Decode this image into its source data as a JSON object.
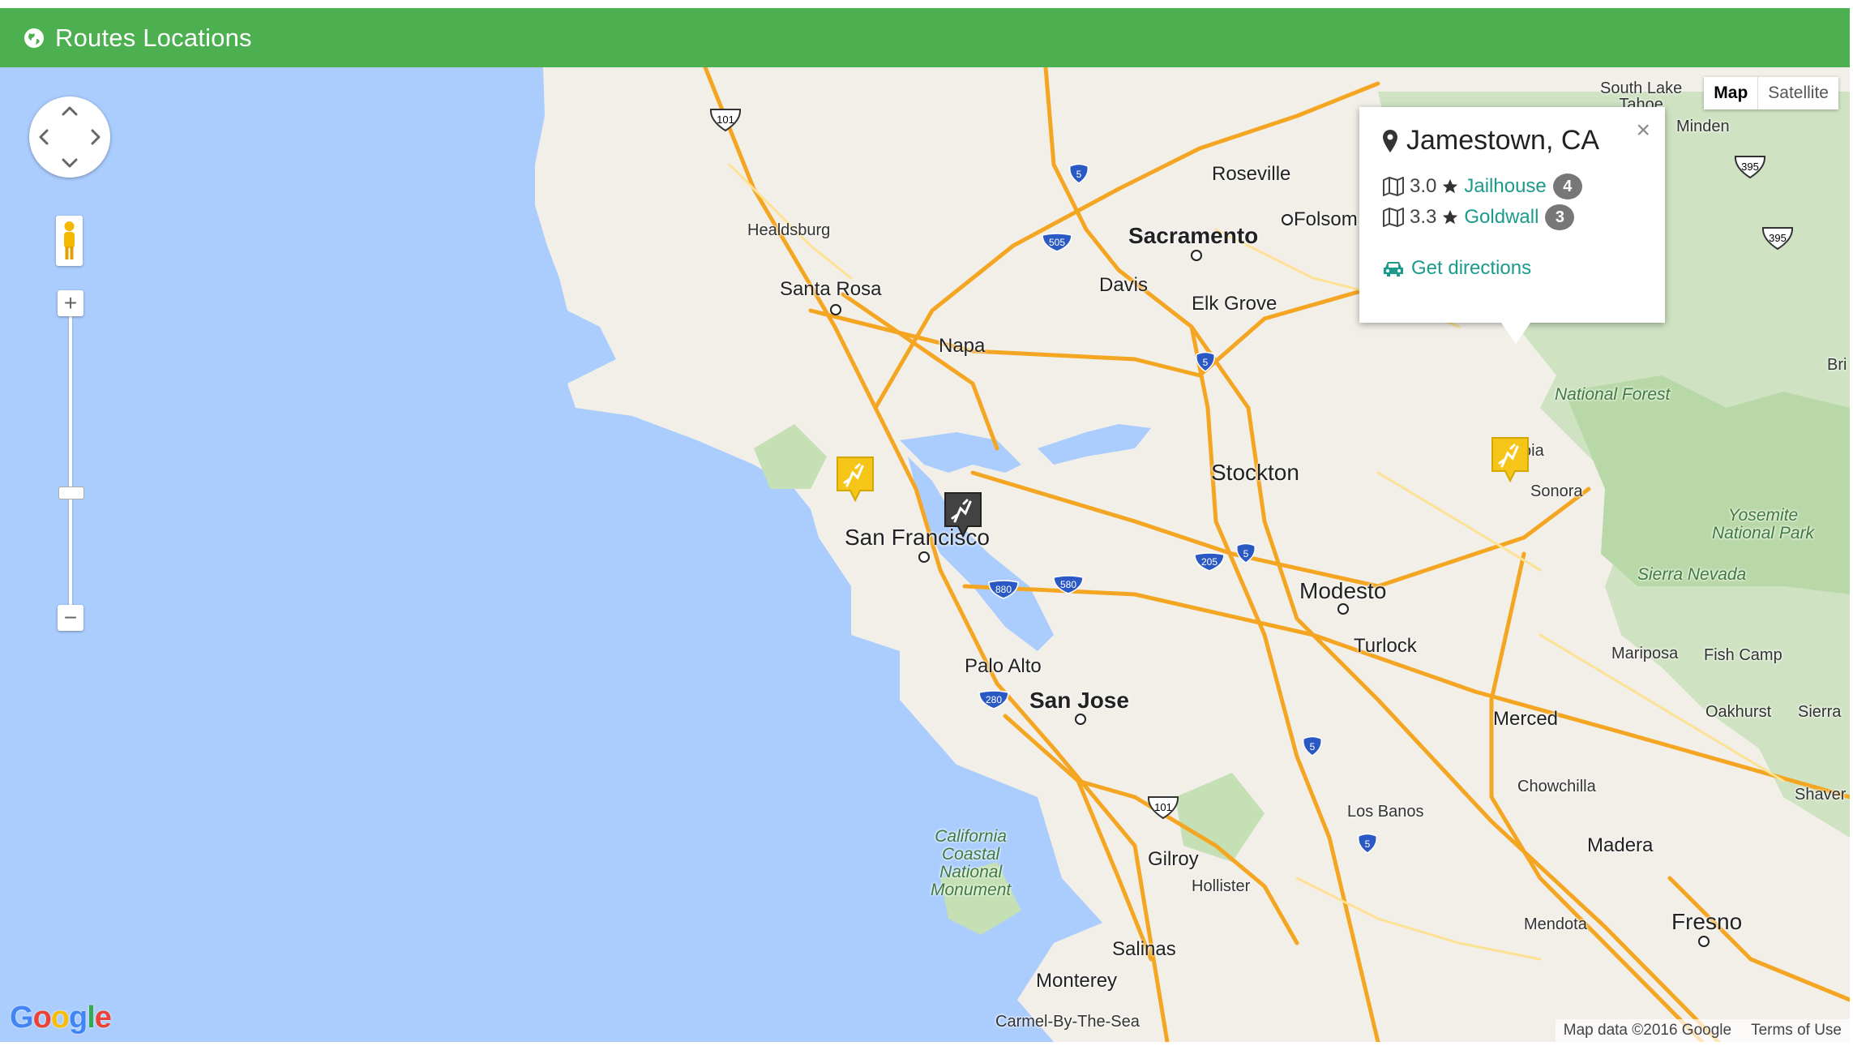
{
  "header": {
    "title": "Routes Locations",
    "icon": "globe-icon"
  },
  "map_type": {
    "options": [
      "Map",
      "Satellite"
    ],
    "active": "Map"
  },
  "zoom": {
    "plus": "+",
    "minus": "−"
  },
  "cities": {
    "south_lake_tahoe": "South Lake\nTahoe",
    "minden": "Minden",
    "roseville": "Roseville",
    "folsom": "Folsom",
    "sacramento": "Sacramento",
    "healdsburg": "Healdsburg",
    "davis": "Davis",
    "elk_grove": "Elk Grove",
    "santa_rosa": "Santa Rosa",
    "napa": "Napa",
    "stockton": "Stockton",
    "san_francisco": "San Francisco",
    "modesto": "Modesto",
    "turlock": "Turlock",
    "palo_alto": "Palo Alto",
    "san_jose": "San Jose",
    "merced": "Merced",
    "mariposa": "Mariposa",
    "fish_camp": "Fish Camp",
    "oakhurst": "Oakhurst",
    "chowchilla": "Chowchilla",
    "los_banos": "Los Banos",
    "madera": "Madera",
    "gilroy": "Gilroy",
    "hollister": "Hollister",
    "salinas": "Salinas",
    "monterey": "Monterey",
    "carmel": "Carmel-By-The-Sea",
    "mendota": "Mendota",
    "fresno": "Fresno",
    "sonora": "Sonora",
    "shaver": "Shaver",
    "sierra_edge": "Sierra",
    "bri": "Bri",
    "oia": "oia"
  },
  "parks": {
    "national_forest": "National Forest",
    "yosemite": "Yosemite\nNational Park",
    "sierra_nevada": "Sierra Nevada",
    "california_coastal": "California\nCoastal\nNational\nMonument"
  },
  "highways": [
    "101",
    "5",
    "505",
    "5",
    "205",
    "5",
    "880",
    "580",
    "280",
    "101",
    "5",
    "5",
    "395",
    "395"
  ],
  "info_window": {
    "location": "Jamestown, CA",
    "routes": [
      {
        "rating": "3.0",
        "name": "Jailhouse",
        "count": "4"
      },
      {
        "rating": "3.3",
        "name": "Goldwall",
        "count": "3"
      }
    ],
    "directions": "Get directions",
    "close": "×"
  },
  "footer": {
    "logo": "Google",
    "map_data": "Map data ©2016 Google",
    "terms": "Terms of Use"
  },
  "colors": {
    "header": "#4caf50",
    "water": "#abcdfe",
    "land": "#f2efe9",
    "highway": "#f4a623",
    "link": "#1a9b8c",
    "marker_yellow": "#f5c518",
    "marker_dark": "#424242"
  }
}
